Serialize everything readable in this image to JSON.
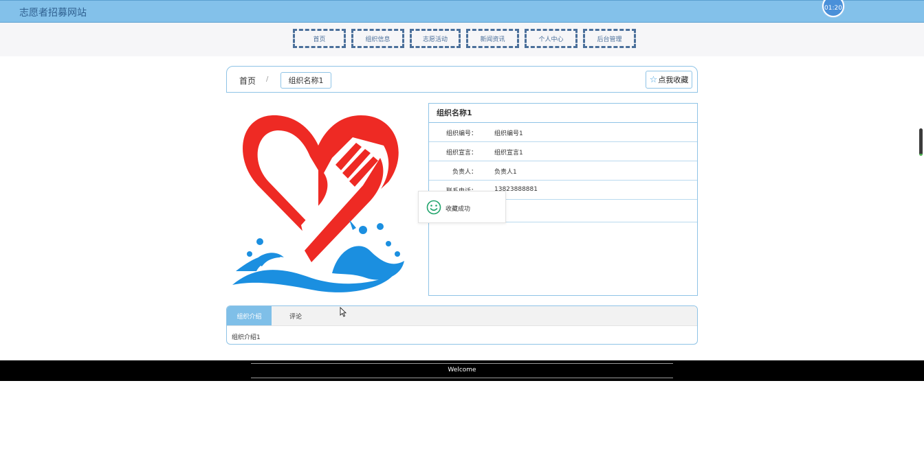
{
  "site": {
    "title": "志愿者招募网站",
    "clock": "01:20"
  },
  "nav": {
    "items": [
      "首页",
      "组织信息",
      "志愿活动",
      "新闻资讯",
      "个人中心",
      "后台管理"
    ]
  },
  "breadcrumb": {
    "home": "首页",
    "separator": "/",
    "current": "组织名称1"
  },
  "favorite": {
    "label": "点我收藏",
    "icon": "star-outline-icon"
  },
  "detail": {
    "title": "组织名称1",
    "rows": [
      {
        "label": "组织编号：",
        "value": "组织编号1"
      },
      {
        "label": "组织宣言：",
        "value": "组织宣言1"
      },
      {
        "label": "负责人：",
        "value": "负责人1"
      },
      {
        "label": "联系电话：",
        "value": "13823888881"
      },
      {
        "label": "",
        "value": ""
      }
    ]
  },
  "toast": {
    "message": "收藏成功",
    "icon": "smile-icon"
  },
  "tabs": {
    "items": [
      "组织介绍",
      "评论"
    ],
    "active": "组织介绍",
    "content": "组织介绍1"
  },
  "footer": {
    "text": "Welcome"
  },
  "colors": {
    "header": "#83c1ea",
    "accent": "#7fbfe8",
    "border": "#8ec3e6",
    "logo_red": "#ee2a24",
    "logo_blue": "#1b8fe0"
  }
}
